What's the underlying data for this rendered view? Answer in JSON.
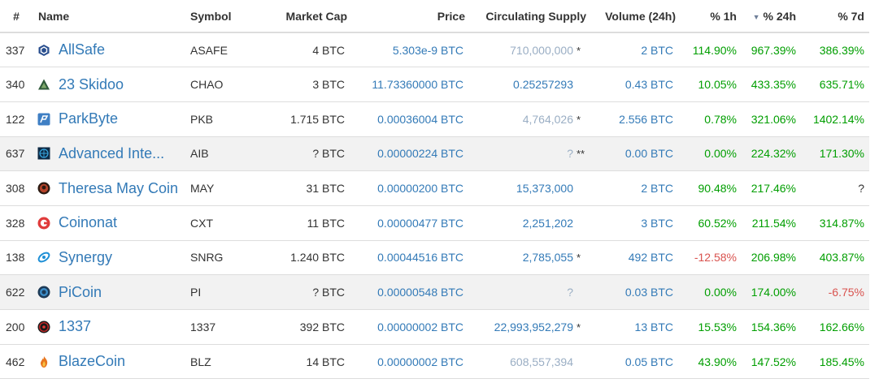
{
  "columns": {
    "rank": "#",
    "name": "Name",
    "symbol": "Symbol",
    "market_cap": "Market Cap",
    "price": "Price",
    "supply": "Circulating Supply",
    "volume": "Volume (24h)",
    "change_1h": "% 1h",
    "change_24h": "% 24h",
    "change_7d": "% 7d",
    "sort_indicator": "▼"
  },
  "colors": {
    "link": "#337ab7",
    "positive": "#009e00",
    "negative": "#d9534f",
    "muted": "#9aaec4",
    "row_shade": "#f2f2f2"
  },
  "rows": [
    {
      "rank": "337",
      "icon": "allsafe-icon",
      "name": "AllSafe",
      "symbol": "ASAFE",
      "market_cap": "4 BTC",
      "price": "5.303e-9 BTC",
      "supply": "710,000,000",
      "supply_note": "*",
      "volume": "2 BTC",
      "h1": "114.90%",
      "h24": "967.39%",
      "d7": "386.39%"
    },
    {
      "rank": "340",
      "icon": "23-skidoo-icon",
      "name": "23 Skidoo",
      "symbol": "CHAO",
      "market_cap": "3 BTC",
      "price": "11.73360000 BTC",
      "supply": "0.25257293",
      "supply_note": "",
      "volume": "0.43 BTC",
      "h1": "10.05%",
      "h24": "433.35%",
      "d7": "635.71%"
    },
    {
      "rank": "122",
      "icon": "parkbyte-icon",
      "name": "ParkByte",
      "symbol": "PKB",
      "market_cap": "1.715 BTC",
      "price": "0.00036004 BTC",
      "supply": "4,764,026",
      "supply_note": "*",
      "volume": "2.556 BTC",
      "h1": "0.78%",
      "h24": "321.06%",
      "d7": "1402.14%"
    },
    {
      "rank": "637",
      "icon": "advanced-internet-blocks-icon",
      "name": "Advanced Inte...",
      "symbol": "AIB",
      "market_cap": "? BTC",
      "price": "0.00000224 BTC",
      "supply": "?",
      "supply_note": "**",
      "volume": "0.00 BTC",
      "h1": "0.00%",
      "h24": "224.32%",
      "d7": "171.30%"
    },
    {
      "rank": "308",
      "icon": "theresa-may-coin-icon",
      "name": "Theresa May Coin",
      "symbol": "MAY",
      "market_cap": "31 BTC",
      "price": "0.00000200 BTC",
      "supply": "15,373,000",
      "supply_note": "",
      "volume": "2 BTC",
      "h1": "90.48%",
      "h24": "217.46%",
      "d7": "?"
    },
    {
      "rank": "328",
      "icon": "coinonat-icon",
      "name": "Coinonat",
      "symbol": "CXT",
      "market_cap": "11 BTC",
      "price": "0.00000477 BTC",
      "supply": "2,251,202",
      "supply_note": "",
      "volume": "3 BTC",
      "h1": "60.52%",
      "h24": "211.54%",
      "d7": "314.87%"
    },
    {
      "rank": "138",
      "icon": "synergy-icon",
      "name": "Synergy",
      "symbol": "SNRG",
      "market_cap": "1.240 BTC",
      "price": "0.00044516 BTC",
      "supply": "2,785,055",
      "supply_note": "*",
      "volume": "492 BTC",
      "h1": "-12.58%",
      "h24": "206.98%",
      "d7": "403.87%"
    },
    {
      "rank": "622",
      "icon": "picoin-icon",
      "name": "PiCoin",
      "symbol": "PI",
      "market_cap": "? BTC",
      "price": "0.00000548 BTC",
      "supply": "?",
      "supply_note": "",
      "volume": "0.03 BTC",
      "h1": "0.00%",
      "h24": "174.00%",
      "d7": "-6.75%"
    },
    {
      "rank": "200",
      "icon": "1337-icon",
      "name": "1337",
      "symbol": "1337",
      "market_cap": "392 BTC",
      "price": "0.00000002 BTC",
      "supply": "22,993,952,279",
      "supply_note": "*",
      "volume": "13 BTC",
      "h1": "15.53%",
      "h24": "154.36%",
      "d7": "162.66%"
    },
    {
      "rank": "462",
      "icon": "blazecoin-icon",
      "name": "BlazeCoin",
      "symbol": "BLZ",
      "market_cap": "14 BTC",
      "price": "0.00000002 BTC",
      "supply": "608,557,394",
      "supply_note": "",
      "volume": "0.05 BTC",
      "h1": "43.90%",
      "h24": "147.52%",
      "d7": "185.45%"
    }
  ]
}
